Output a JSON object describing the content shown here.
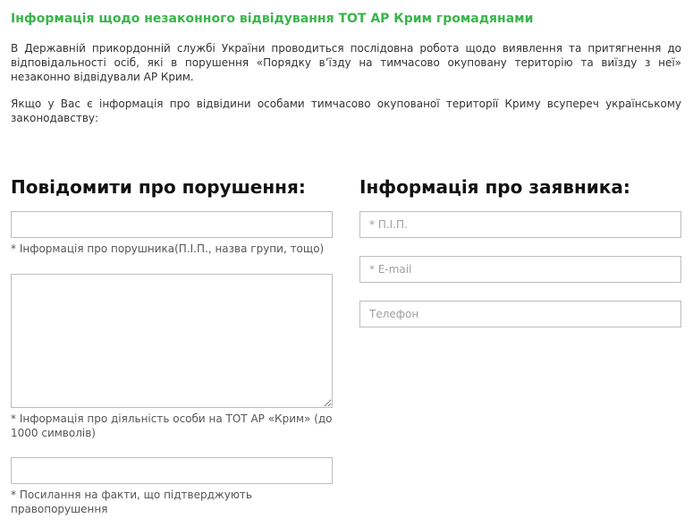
{
  "header": {
    "title": "Інформація щодо незаконного відвідування ТОТ АР Крим громадянами"
  },
  "intro": {
    "paragraph1": "В Державній прикордонній службі України проводиться послідовна робота щодо виявлення та притягнення до відповідальності осіб, які в порушення «Порядку в’їзду на тимчасово окуповану територію та виїзду з неї» незаконно відвідували АР Крим.",
    "paragraph2": "Якщо у Вас є інформація про відвідини особами тимчасово окупованої території Криму всупереч українському законодавству:"
  },
  "report_form": {
    "heading": "Повідомити про порушення:",
    "violator": {
      "value": "",
      "hint": "* Інформація про порушника(П.І.П., назва групи, тощо)"
    },
    "activity": {
      "value": "",
      "hint": "* Інформація про діяльність особи на ТОТ АР «Крим» (до 1000 символів)"
    },
    "links": {
      "value": "",
      "hint": "* Посилання на факти, що підтверджують правопорушення"
    }
  },
  "applicant_form": {
    "heading": "Інформація про заявника:",
    "name": {
      "value": "",
      "placeholder": "* П.І.П."
    },
    "email": {
      "value": "",
      "placeholder": "* E-mail"
    },
    "phone": {
      "value": "",
      "placeholder": "Телефон"
    }
  },
  "colors": {
    "title_green": "#39b54a",
    "border_gray": "#bdbdbd"
  }
}
